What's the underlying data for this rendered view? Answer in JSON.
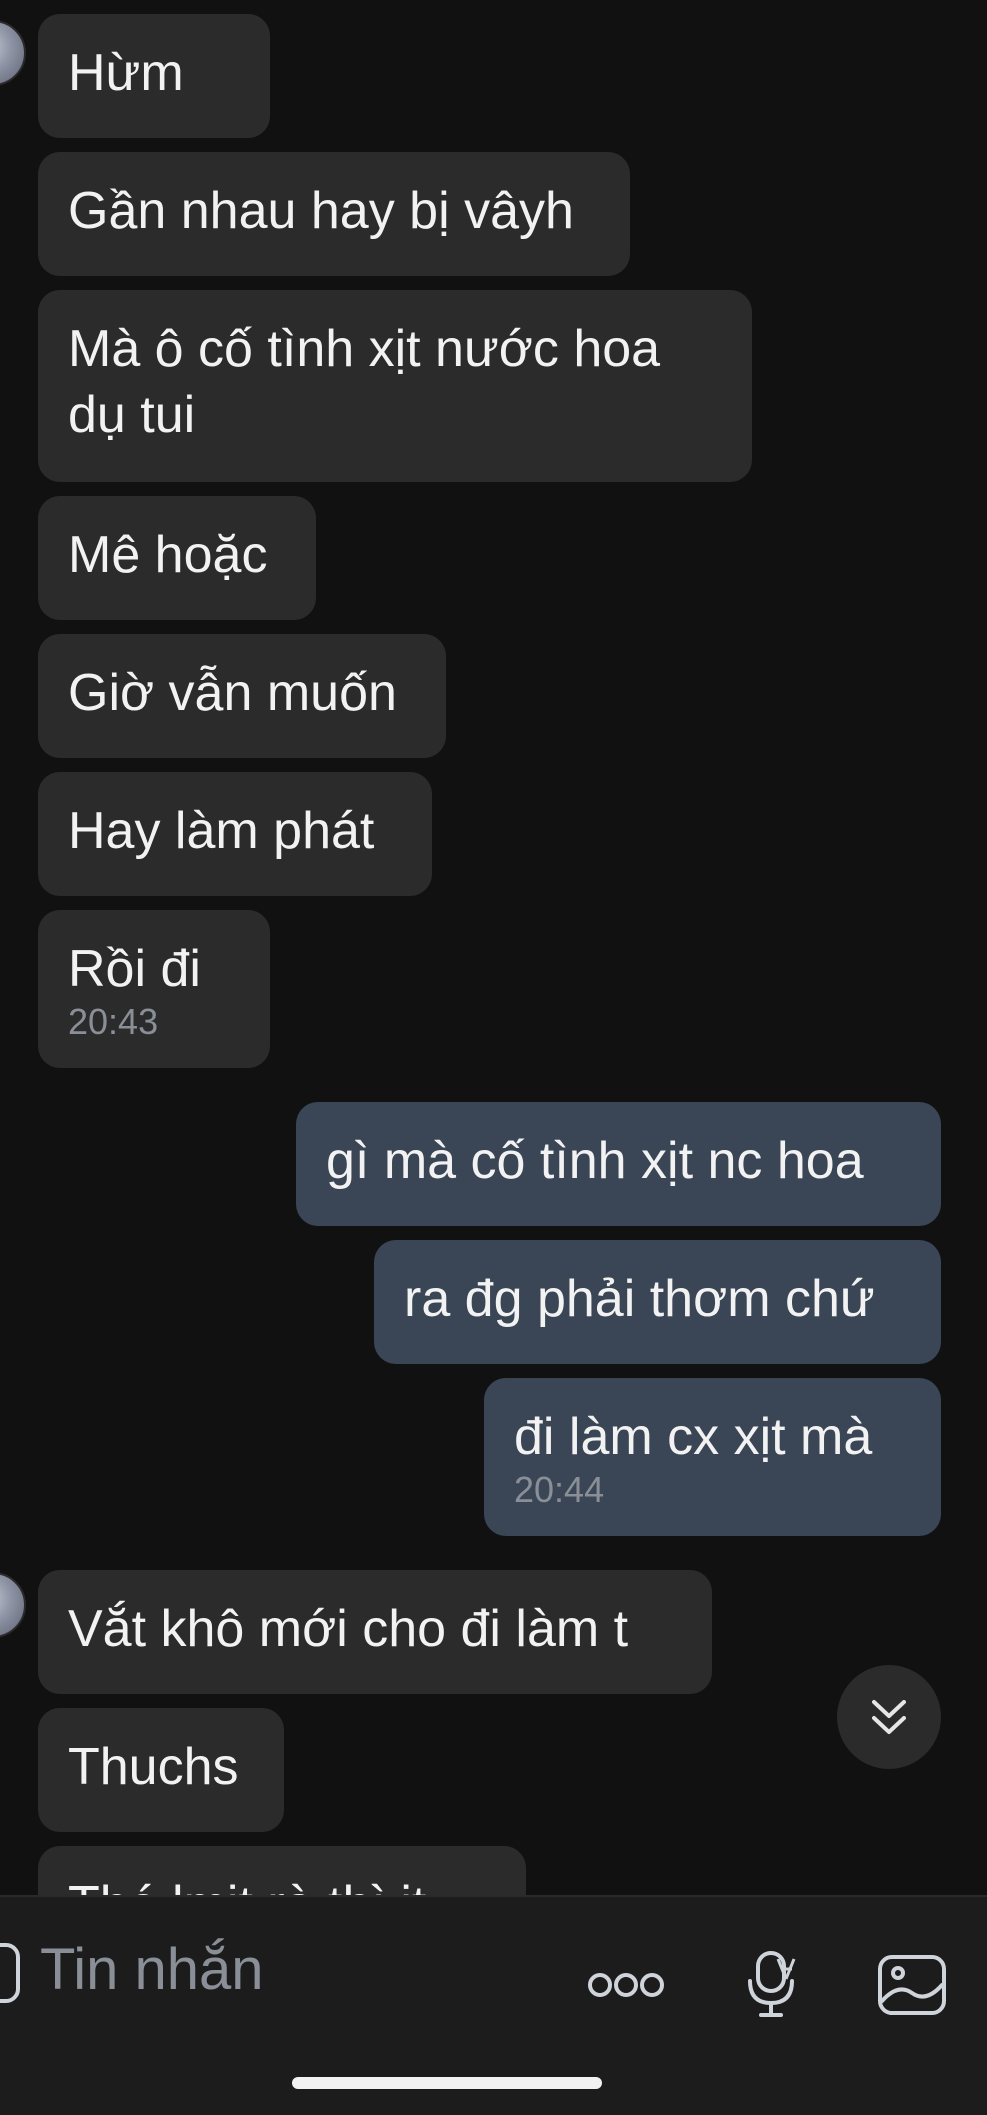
{
  "conversation": {
    "incoming_group_1": [
      {
        "text": "Hừm"
      },
      {
        "text": "Gần nhau hay bị vâyh"
      },
      {
        "text": "Mà ô cố tình xịt nước hoa",
        "text2": "dụ tui"
      },
      {
        "text": "Mê hoặc"
      },
      {
        "text": "Giờ vẫn muốn"
      },
      {
        "text": "Hay làm phát"
      },
      {
        "text": "Rồi đi",
        "time": "20:43"
      }
    ],
    "outgoing_group": [
      {
        "text": "gì mà cố tình xịt nc hoa"
      },
      {
        "text": "ra đg phải thơm chứ"
      },
      {
        "text": "đi làm cx xịt mà",
        "time": "20:44"
      }
    ],
    "incoming_group_2": [
      {
        "text": "Vắt khô mới cho đi làm t"
      },
      {
        "text": "Thuchs"
      },
      {
        "text": "Thé lmit rà thì it"
      }
    ]
  },
  "composer": {
    "placeholder": "Tin nhắn"
  },
  "icons": {
    "scroll_down": "double-chevron-down-icon",
    "more": "more-dots-icon",
    "voice": "microphone-icon",
    "gallery": "image-icon"
  },
  "colors": {
    "background": "#111111",
    "incoming_bubble": "#2b2b2b",
    "outgoing_bubble": "#3a4655",
    "text": "#f2f2f2",
    "timestamp": "#8a8f97"
  }
}
